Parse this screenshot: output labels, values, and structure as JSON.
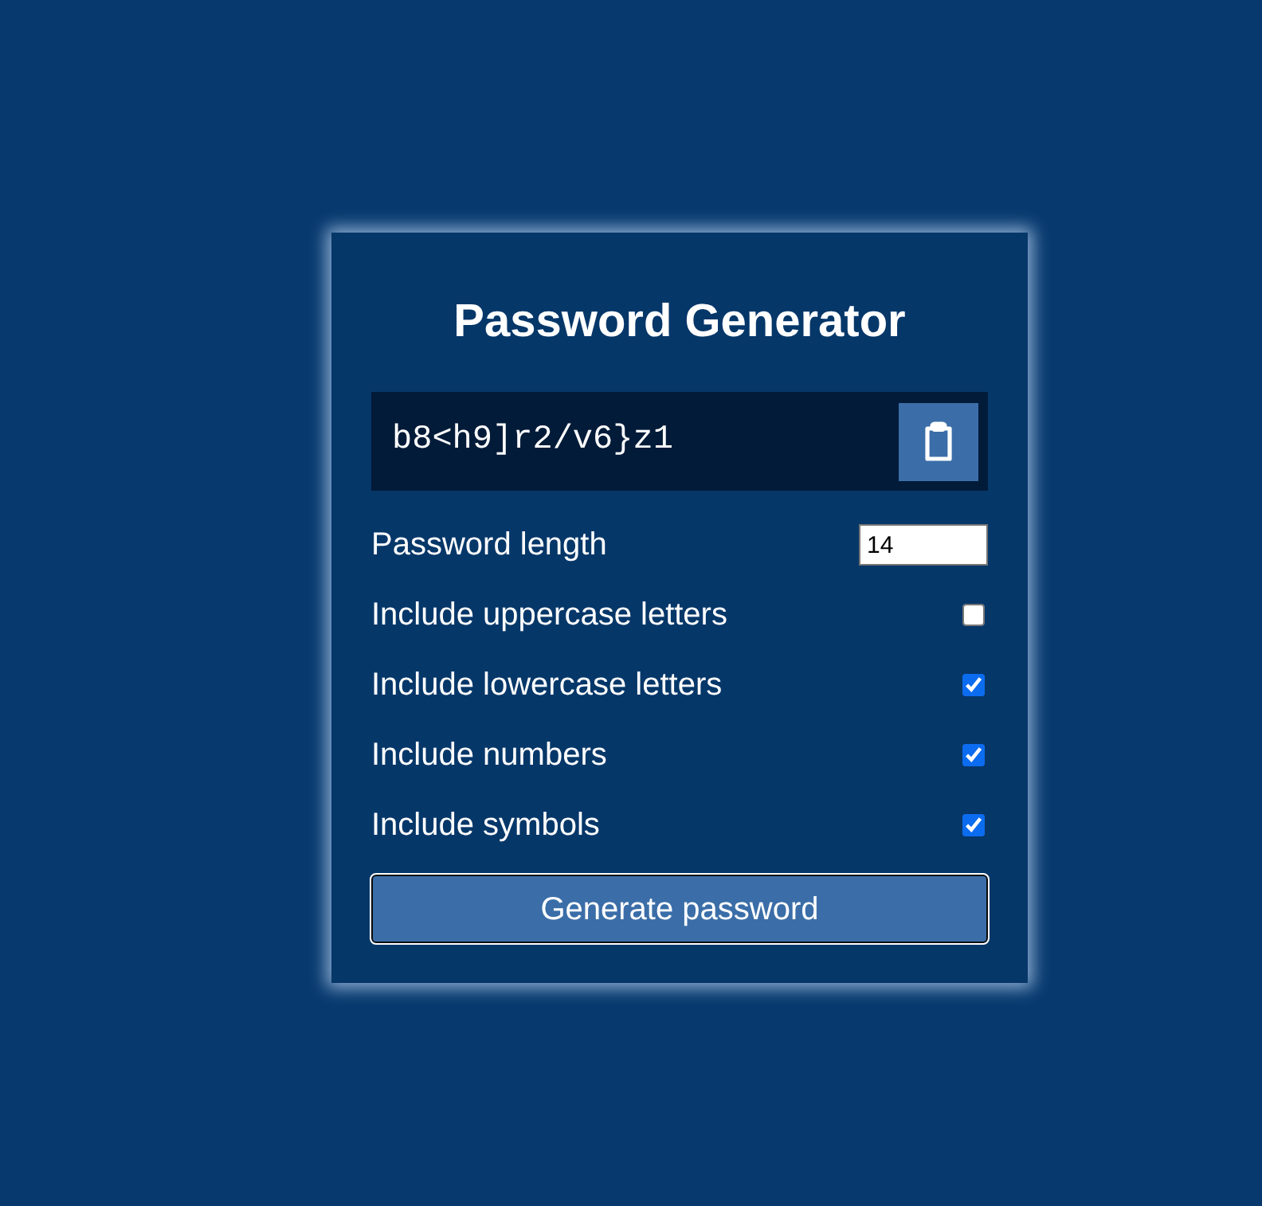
{
  "title": "Password Generator",
  "result": {
    "password": "b8<h9]r2/v6}z1"
  },
  "length": {
    "label": "Password length",
    "value": "14"
  },
  "options": [
    {
      "label": "Include uppercase letters",
      "checked": false
    },
    {
      "label": "Include lowercase letters",
      "checked": true
    },
    {
      "label": "Include numbers",
      "checked": true
    },
    {
      "label": "Include symbols",
      "checked": true
    }
  ],
  "button": {
    "label": "Generate password"
  }
}
